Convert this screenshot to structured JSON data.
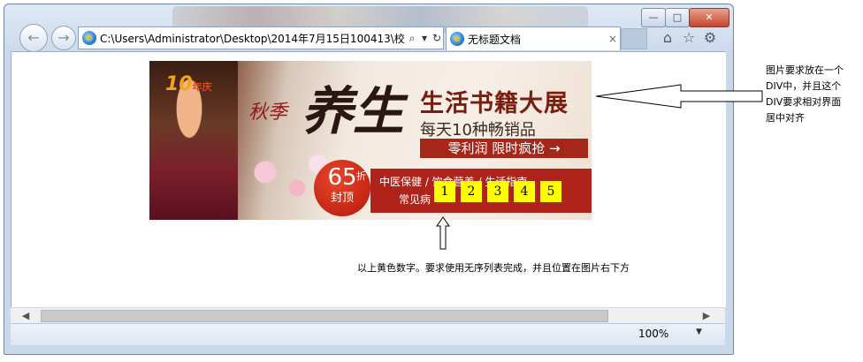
{
  "window": {
    "minimize_label": "—",
    "maximize_label": "□",
    "close_label": "✕"
  },
  "toolbar": {
    "back_label": "←",
    "forward_label": "→",
    "address": "C:\\Users\\Administrator\\Desktop\\2014年7月15日100413\\校",
    "search_icon": "⌕",
    "refresh_icon": "↻",
    "home_icon": "⌂",
    "favorites_icon": "☆",
    "settings_icon": "⚙"
  },
  "tab": {
    "title": "无标题文档",
    "close": "×"
  },
  "banner": {
    "anniversary_num": "10",
    "anniversary_text": "年庆",
    "season": "秋季",
    "yangsheng": "养生",
    "headline": "生活书籍大展",
    "subline": "每天10种畅销品",
    "profit": "零利润  限时疯抢 →",
    "discount_num": "65",
    "discount_unit": "折",
    "discount_caption": "封顶",
    "categories_line1": "中医保健 /  饮食营养 /  生活指南",
    "categories_line2": "常见病"
  },
  "number_list": [
    "1",
    "2",
    "3",
    "4",
    "5"
  ],
  "status": {
    "zoom": "100%",
    "caret": "▼"
  },
  "scrollbar": {
    "left_arrow": "◀",
    "right_arrow": "▶"
  },
  "annotations": {
    "right_note": "图片要求放在一个DIV中，并且这个DIV要求相对界面居中对齐",
    "bottom_note": "以上黄色数字。要求使用无序列表完成，并且位置在图片右下方"
  }
}
